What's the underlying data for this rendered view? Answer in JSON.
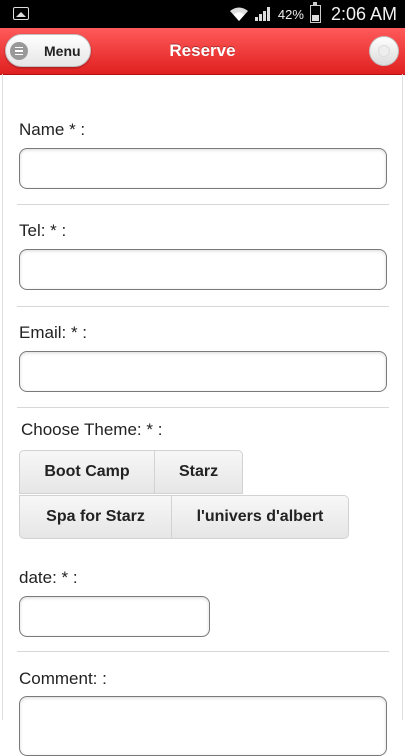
{
  "status_bar": {
    "battery_percent": "42%",
    "time": "2:06 AM",
    "icons": [
      "image-icon",
      "wifi-icon",
      "signal-icon",
      "battery-icon"
    ]
  },
  "header": {
    "menu_label": "Menu",
    "title": "Reserve",
    "accent_color": "#e53232"
  },
  "form": {
    "name_label": "Name * :",
    "tel_label": "Tel: * :",
    "email_label": "Email: * :",
    "theme_label": "Choose Theme: * :",
    "themes": [
      "Boot Camp",
      "Starz",
      "Spa for Starz",
      "l'univers d'albert"
    ],
    "date_label": "date: * :",
    "comment_label": "Comment: :"
  }
}
